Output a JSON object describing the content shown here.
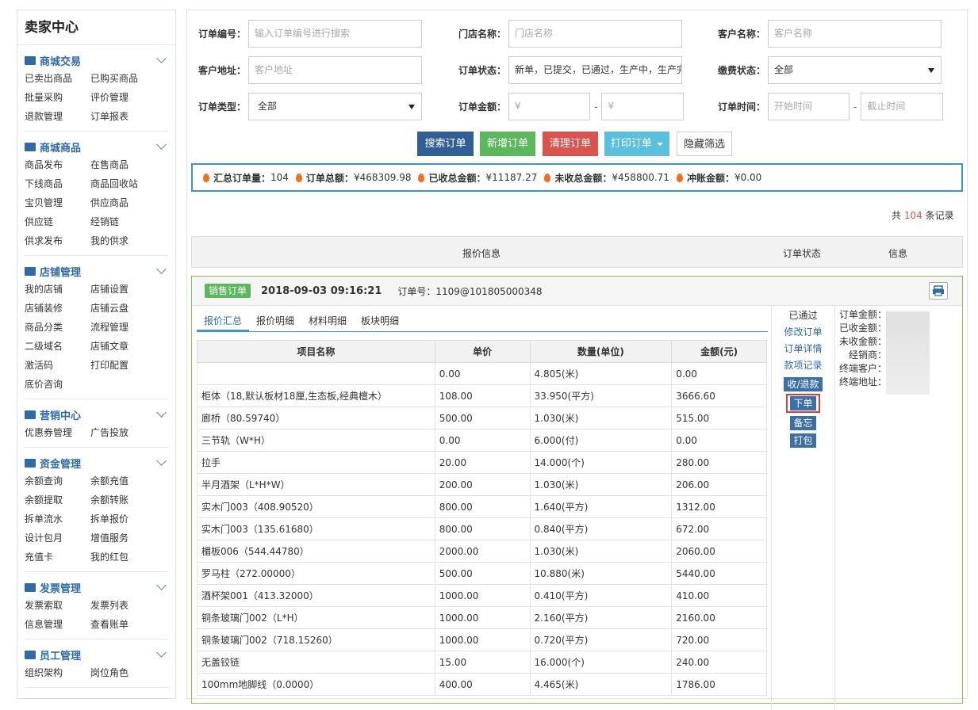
{
  "sidebar": {
    "brand": "卖家中心",
    "sections": [
      {
        "title": "商城交易",
        "links": [
          "已卖出商品",
          "已购买商品",
          "批量采购",
          "评价管理",
          "退款管理",
          "订单报表"
        ]
      },
      {
        "title": "商城商品",
        "links": [
          "商品发布",
          "在售商品",
          "下线商品",
          "商品回收站",
          "宝贝管理",
          "供应商品",
          "供应链",
          "经销链",
          "供求发布",
          "我的供求"
        ]
      },
      {
        "title": "店铺管理",
        "links": [
          "我的店铺",
          "店铺设置",
          "店铺装修",
          "店铺云盘",
          "商品分类",
          "流程管理",
          "二级域名",
          "店铺文章",
          "激活码",
          "打印配置",
          "底价咨询"
        ]
      },
      {
        "title": "营销中心",
        "links": [
          "优惠券管理",
          "广告投放"
        ]
      },
      {
        "title": "资金管理",
        "links": [
          "余额查询",
          "余额充值",
          "余额提取",
          "余额转账",
          "拆单流水",
          "拆单报价",
          "设计包月",
          "增值服务",
          "充值卡",
          "我的红包"
        ]
      },
      {
        "title": "发票管理",
        "links": [
          "发票索取",
          "发票列表",
          "信息管理",
          "查看账单"
        ]
      },
      {
        "title": "员工管理",
        "links": [
          "组织架构",
          "岗位角色"
        ]
      }
    ]
  },
  "filters": {
    "order_no": {
      "label": "订单编号：",
      "placeholder": "输入订单编号进行搜索"
    },
    "store": {
      "label": "门店名称：",
      "placeholder": "门店名称"
    },
    "customer": {
      "label": "客户名称：",
      "placeholder": "客户名称"
    },
    "address": {
      "label": "客户地址：",
      "placeholder": "客户地址"
    },
    "status": {
      "label": "订单状态：",
      "value": "新单，已提交，已通过，生产中，生产完"
    },
    "pay_status": {
      "label": "缴费状态：",
      "value": "全部"
    },
    "type": {
      "label": "订单类型：",
      "value": "全部"
    },
    "amount": {
      "label": "订单金额：",
      "min_placeholder": "¥",
      "max_placeholder": "¥",
      "sep": "-"
    },
    "time": {
      "label": "订单时间：",
      "start_placeholder": "开始时间",
      "end_placeholder": "截止时间",
      "sep": "-"
    }
  },
  "buttons": {
    "search": "搜索订单",
    "add": "新增订单",
    "clear": "清理订单",
    "print": "打印订单",
    "hide": "隐藏筛选"
  },
  "colors": {
    "search": "#2f5f95",
    "add": "#5cb85c",
    "clear": "#d9534f",
    "print": "#5bc0de",
    "accent": "#3a95d6"
  },
  "summary": {
    "total_orders_label": "汇总订单量：",
    "total_orders": "104",
    "total_amount_label": "订单总额：",
    "total_amount": "¥468309.98",
    "received_label": "已收总金额：",
    "received": "¥11187.27",
    "unreceived_label": "未收总金额：",
    "unreceived": "¥458800.71",
    "offset_label": "冲账金额：",
    "offset": "¥0.00"
  },
  "records": {
    "prefix": "共",
    "count": "104",
    "suffix": "条记录"
  },
  "list_header": {
    "col1": "报价信息",
    "col2": "订单状态",
    "col3": "信息"
  },
  "order": {
    "tag": "销售订单",
    "datetime": "2018-09-03 09:16:21",
    "order_no": "订单号：1109@101805000348",
    "tabs": [
      "报价汇总",
      "报价明细",
      "材料明细",
      "板块明细"
    ],
    "columns": [
      "项目名称",
      "单价",
      "数量(单位)",
      "金额(元)"
    ],
    "rows": [
      [
        "",
        "0.00",
        "4.805(米)",
        "0.00"
      ],
      [
        "柜体（18,默认板材18厘,生态板,经典檀木）",
        "108.00",
        "33.950(平方)",
        "3666.60"
      ],
      [
        "廊桥（80.59740）",
        "500.00",
        "1.030(米)",
        "515.00"
      ],
      [
        "三节轨（W*H）",
        "0.00",
        "6.000(付)",
        "0.00"
      ],
      [
        "拉手",
        "20.00",
        "14.000(个)",
        "280.00"
      ],
      [
        "半月酒架（L*H*W）",
        "200.00",
        "1.030(米)",
        "206.00"
      ],
      [
        "实木门003（408.90520）",
        "800.00",
        "1.640(平方)",
        "1312.00"
      ],
      [
        "实木门003（135.61680）",
        "800.00",
        "0.840(平方)",
        "672.00"
      ],
      [
        "楣板006（544.44780）",
        "2000.00",
        "1.030(米)",
        "2060.00"
      ],
      [
        "罗马柱（272.00000）",
        "500.00",
        "10.880(米)",
        "5440.00"
      ],
      [
        "酒杯架001（413.32000）",
        "1000.00",
        "0.410(平方)",
        "410.00"
      ],
      [
        "铜条玻璃门002（L*H）",
        "1000.00",
        "2.160(平方)",
        "2160.00"
      ],
      [
        "铜条玻璃门002（718.15260）",
        "1000.00",
        "0.720(平方)",
        "720.00"
      ],
      [
        "无盖铰链",
        "15.00",
        "16.000(个)",
        "240.00"
      ],
      [
        "100mm地脚线（0.0000）",
        "400.00",
        "4.465(米)",
        "1786.00"
      ]
    ],
    "status": "已通过",
    "links": [
      "修改订单",
      "订单详情",
      "款项记录"
    ],
    "action_buttons": [
      "收/退款",
      "下单",
      "备忘",
      "打包"
    ],
    "info_labels": [
      "订单金额：",
      "已收金额：",
      "未收金额：",
      "经销商：",
      "终端客户：",
      "终端地址："
    ]
  }
}
